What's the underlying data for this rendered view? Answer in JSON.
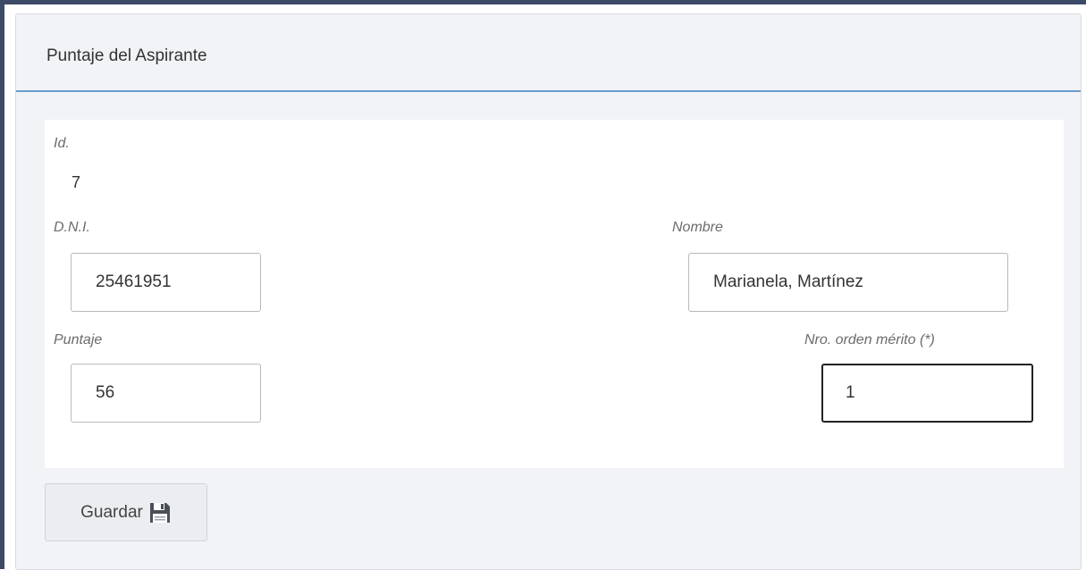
{
  "panel": {
    "title": "Puntaje del Aspirante"
  },
  "form": {
    "id_label": "Id.",
    "id_value": "7",
    "dni_label": "D.N.I.",
    "dni_value": "25461951",
    "nombre_label": "Nombre",
    "nombre_value": "Marianela, Martínez",
    "puntaje_label": "Puntaje",
    "puntaje_value": "56",
    "orden_label": "Nro. orden mérito (*)",
    "orden_value": "1"
  },
  "actions": {
    "save_label": "Guardar",
    "save_icon": "floppy-disk-icon"
  },
  "colors": {
    "header_border": "#6b9bd1",
    "frame_border": "#3b4a66",
    "panel_bg": "#f1f3f6"
  }
}
